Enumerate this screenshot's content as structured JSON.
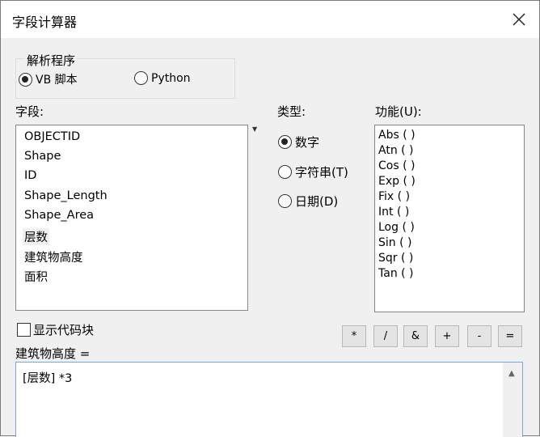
{
  "window": {
    "title": "字段计算器"
  },
  "parser": {
    "legend": "解析程序",
    "options": [
      {
        "label": "VB 脚本",
        "checked": true
      },
      {
        "label": "Python",
        "checked": false
      }
    ]
  },
  "fields": {
    "label": "字段:",
    "items": [
      "OBJECTID",
      "Shape",
      "ID",
      "Shape_Length",
      "Shape_Area",
      "层数",
      "建筑物高度",
      "面积"
    ],
    "selected": "层数"
  },
  "type": {
    "label": "类型:",
    "options": [
      {
        "label": "数字",
        "checked": true
      },
      {
        "label": "字符串(T)",
        "checked": false
      },
      {
        "label": "日期(D)",
        "checked": false
      }
    ]
  },
  "functions": {
    "label": "功能(U):",
    "items": [
      "Abs ( )",
      "Atn ( )",
      "Cos ( )",
      "Exp ( )",
      "Fix ( )",
      "Int ( )",
      "Log ( )",
      "Sin ( )",
      "Sqr ( )",
      "Tan ( )"
    ]
  },
  "codeblock": {
    "label": "显示代码块",
    "checked": false
  },
  "operators": [
    "*",
    "/",
    "&",
    "+",
    "-",
    "="
  ],
  "expression": {
    "target_label": "建筑物高度 =",
    "value": "[层数] *3"
  }
}
